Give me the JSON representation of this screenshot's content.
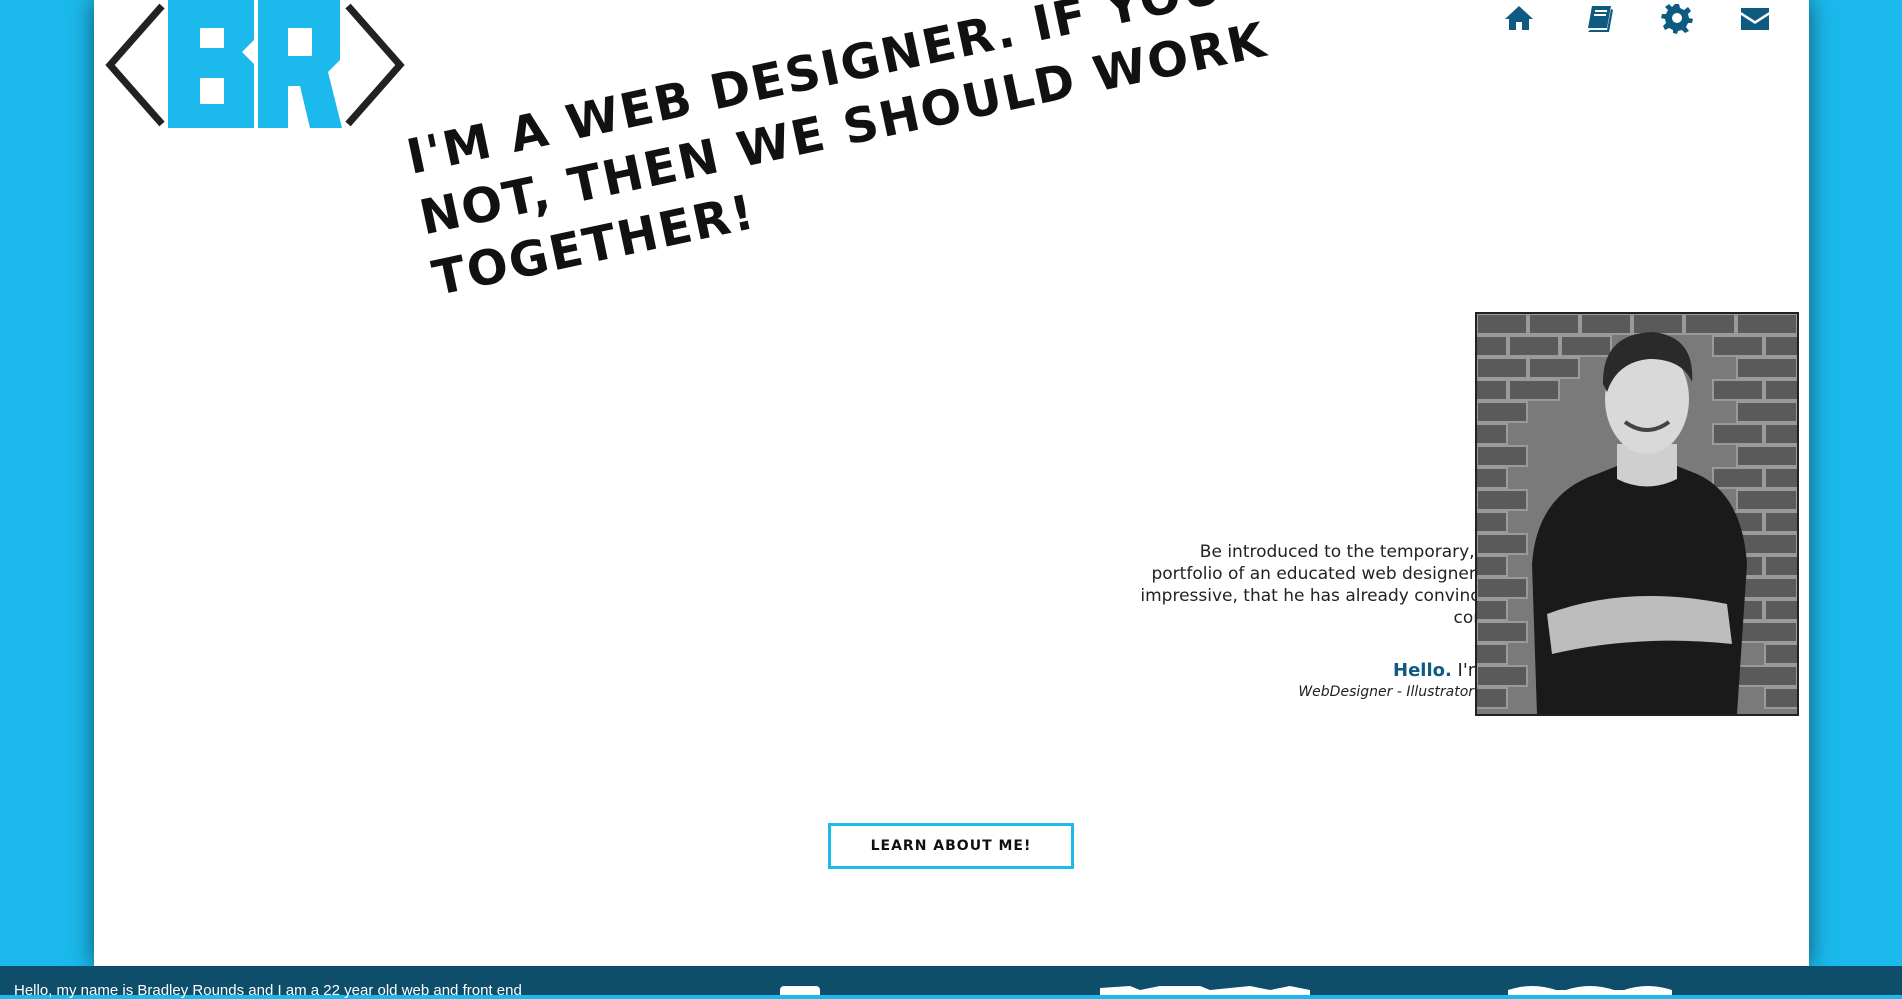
{
  "brand": {
    "logo_letters": "BR",
    "accent_color": "#1bb9ec",
    "dark_color": "#0e4e6a"
  },
  "nav": {
    "items": [
      {
        "icon": "home-icon",
        "label": "Home"
      },
      {
        "icon": "book-icon",
        "label": "Portfolio"
      },
      {
        "icon": "gear-icon",
        "label": "Services"
      },
      {
        "icon": "envelope-icon",
        "label": "Contact"
      }
    ]
  },
  "hero": {
    "tagline": "I'm a web designer. If you're not, then we should work together!"
  },
  "intro": {
    "text": "Be introduced to the temporary, ever-fluid portfolio of an educated web designer who is so impressive, that he has already convinced you to contact him.",
    "hello_word": "Hello.",
    "hello_rest": " I'm Bradley",
    "roles": "WebDesigner - Illustrator - Developer"
  },
  "cta": {
    "label": "Learn about me!"
  },
  "footer": {
    "text": "Hello, my name is Bradley Rounds and I am a 22 year old web and front end"
  }
}
